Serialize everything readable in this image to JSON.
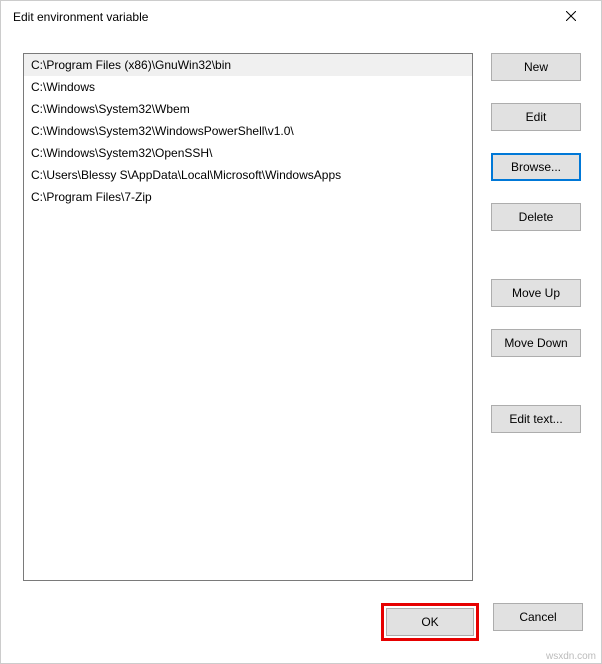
{
  "window": {
    "title": "Edit environment variable"
  },
  "list": {
    "items": [
      "C:\\Program Files (x86)\\GnuWin32\\bin",
      "C:\\Windows",
      "C:\\Windows\\System32\\Wbem",
      "C:\\Windows\\System32\\WindowsPowerShell\\v1.0\\",
      "C:\\Windows\\System32\\OpenSSH\\",
      "C:\\Users\\Blessy S\\AppData\\Local\\Microsoft\\WindowsApps",
      "C:\\Program Files\\7-Zip"
    ],
    "selected_index": 0
  },
  "buttons": {
    "new": "New",
    "edit": "Edit",
    "browse": "Browse...",
    "delete": "Delete",
    "move_up": "Move Up",
    "move_down": "Move Down",
    "edit_text": "Edit text...",
    "ok": "OK",
    "cancel": "Cancel"
  },
  "watermark": "wsxdn.com"
}
